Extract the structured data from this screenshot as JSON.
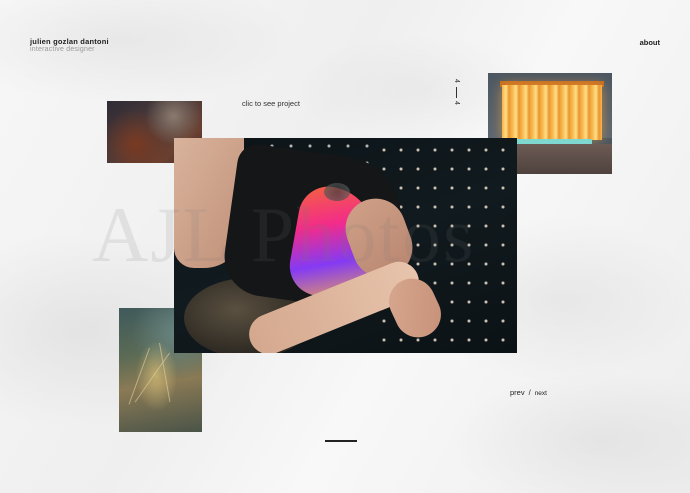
{
  "header": {
    "name": "julien gozlan dantoni",
    "role": "interactive designer",
    "about": "about"
  },
  "project": {
    "cta": "clic to see project",
    "title": "AJL Photos",
    "counter_current": "4",
    "counter_total": "4"
  },
  "pager": {
    "prev": "prev",
    "separator": "/",
    "next": "next"
  },
  "colors": {
    "background": "#f4f4f4",
    "text": "#222222",
    "muted": "#999999"
  }
}
